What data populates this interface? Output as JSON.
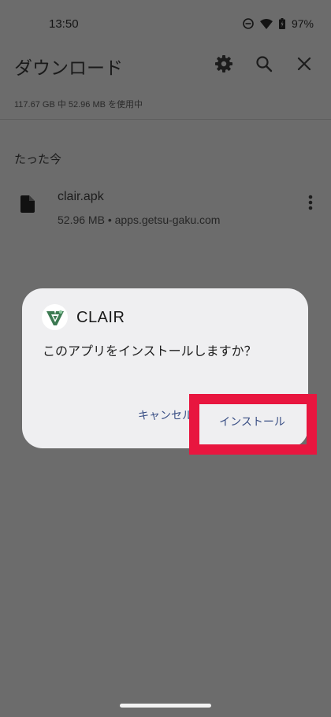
{
  "status_bar": {
    "time": "13:50",
    "battery": "97%",
    "icons": [
      "do-not-disturb-icon",
      "wifi-icon",
      "battery-icon"
    ]
  },
  "app_bar": {
    "title": "ダウンロード",
    "actions": [
      "settings-icon",
      "search-icon",
      "close-icon"
    ]
  },
  "storage_info": "117.67 GB 中 52.96 MB を使用中",
  "section_label": "たった今",
  "file": {
    "name": "clair.apk",
    "meta": "52.96 MB • apps.getsu-gaku.com",
    "icon": "file-icon"
  },
  "dialog": {
    "app_name": "CLAIR",
    "message": "このアプリをインストールしますか？",
    "cancel_label": "キャンセル",
    "install_label": "インストール"
  },
  "colors": {
    "scrim_background": "#6c6c6c",
    "dialog_background": "#efeff1",
    "button_text": "#3a4f85",
    "highlight": "#e8163f",
    "clair_brand": "#3d7a52"
  }
}
